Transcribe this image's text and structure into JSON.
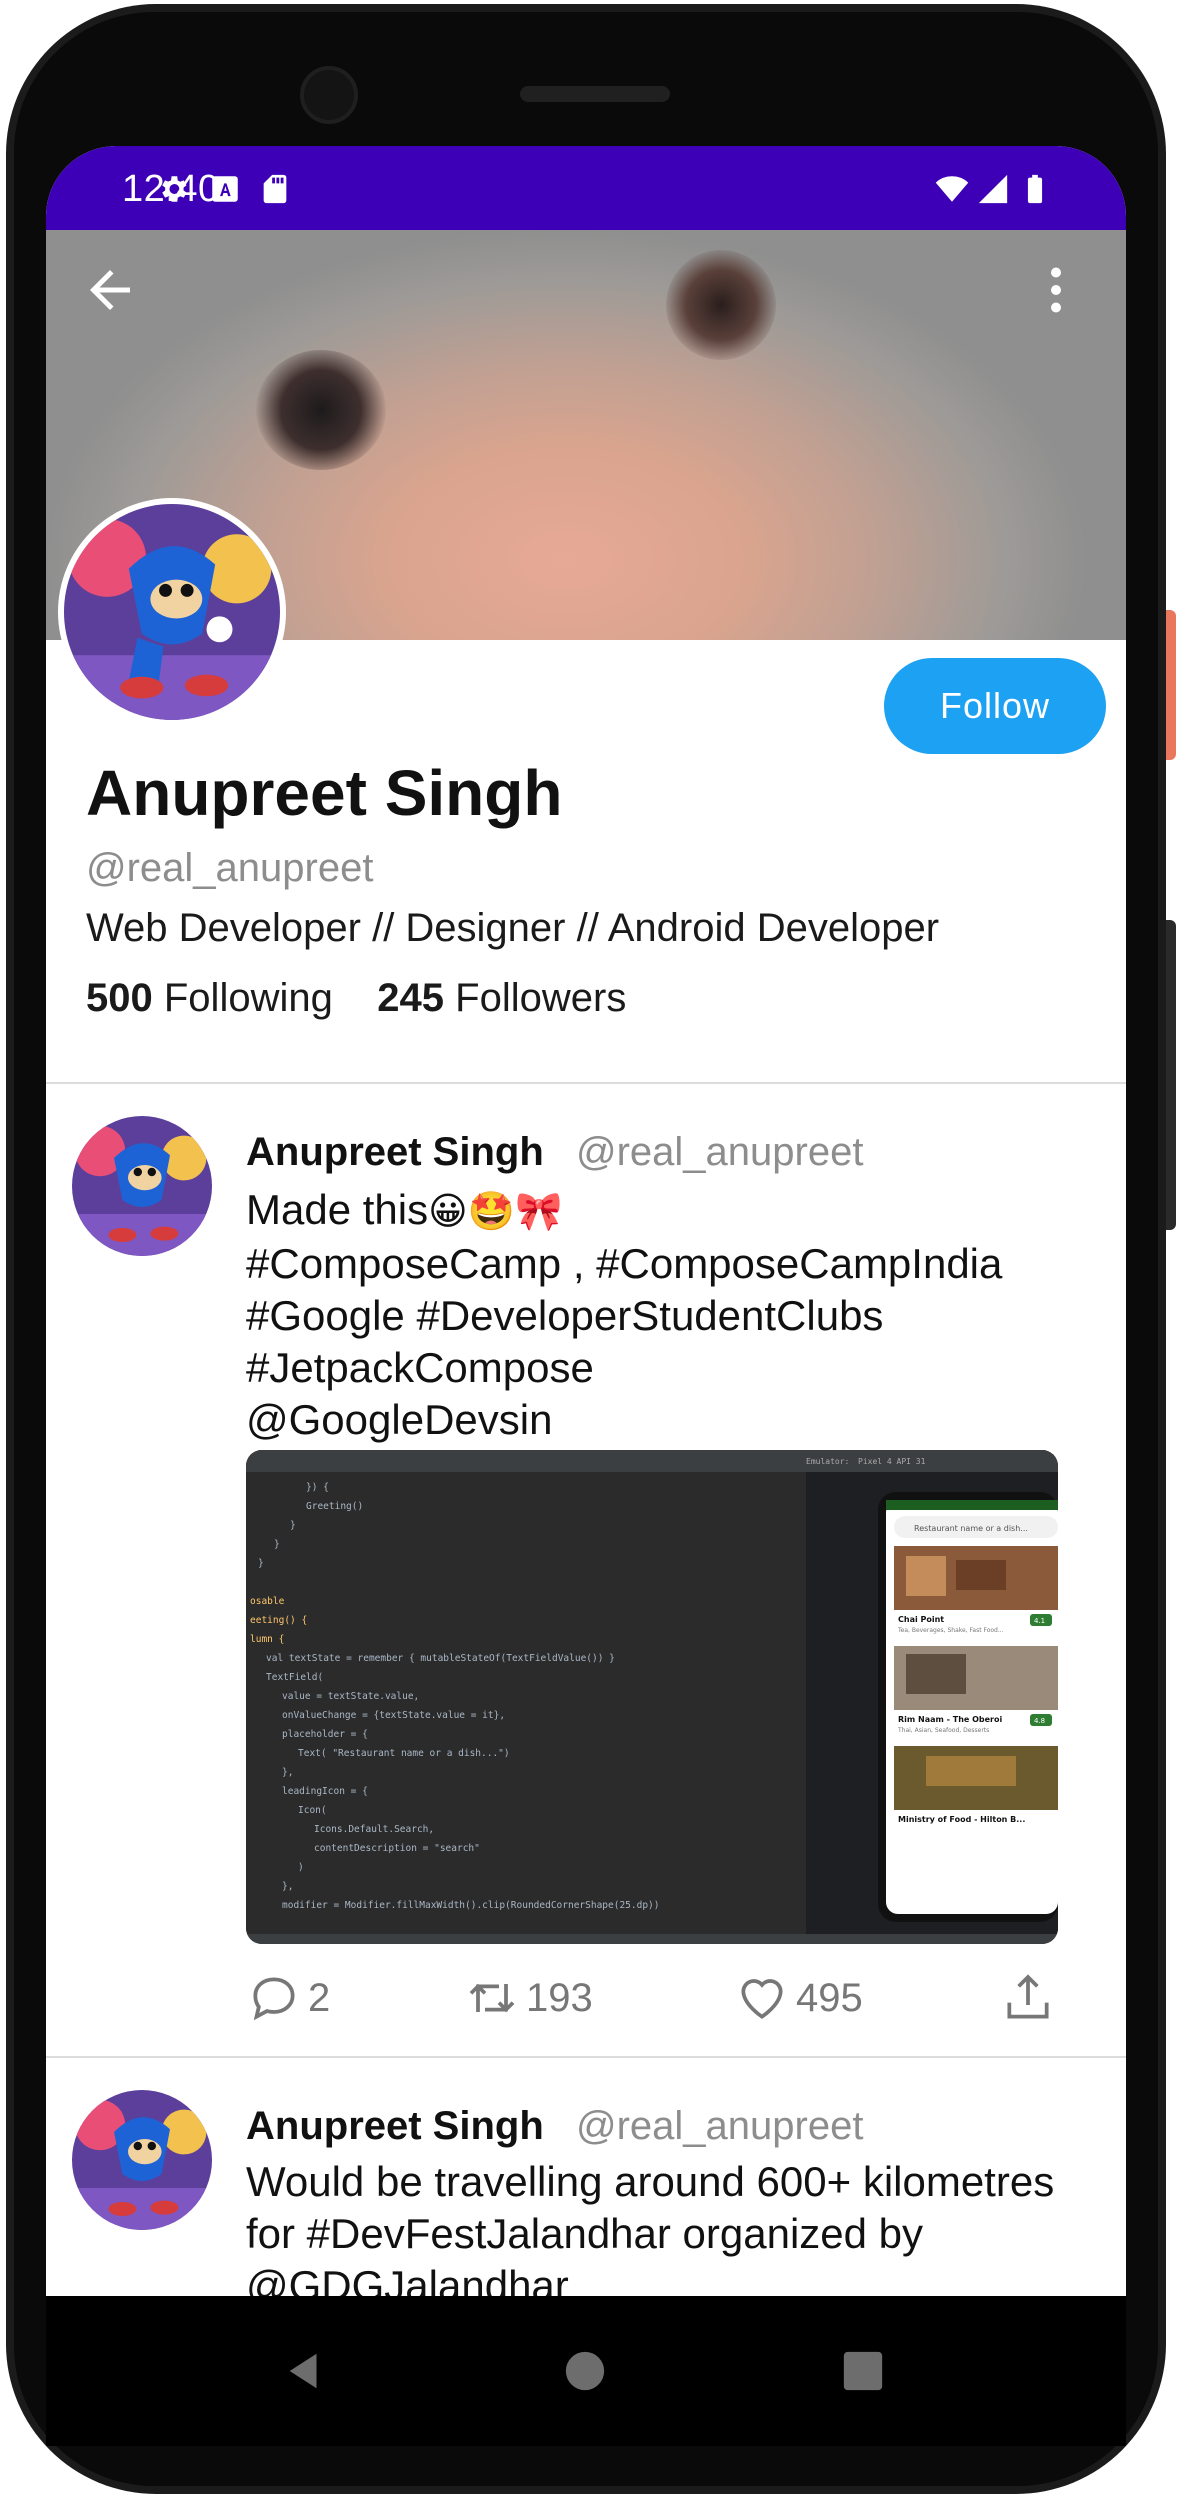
{
  "status_bar": {
    "time": "12:40",
    "left_icons": [
      "settings-icon",
      "text-a-icon",
      "sd-card-icon"
    ],
    "right_icons": [
      "wifi-icon",
      "signal-icon",
      "battery-icon"
    ],
    "background": "#3d00b7"
  },
  "header": {
    "back_icon": "arrow-back-icon",
    "more_icon": "more-vert-icon"
  },
  "profile": {
    "name": "Anupreet Singh",
    "handle": "@real_anupreet",
    "bio": "Web Developer // Designer // Android Developer",
    "following_count": "500",
    "following_label": "Following",
    "followers_count": "245",
    "followers_label": "Followers",
    "follow_button": "Follow",
    "accent": "#1da1f2"
  },
  "tweets": [
    {
      "name": "Anupreet Singh",
      "handle": "@real_anupreet",
      "lines": [
        "Made this",
        "#ComposeCamp , #ComposeCampIndia",
        "#Google #DeveloperStudentClubs",
        "#JetpackCompose",
        "@GoogleDevsin"
      ],
      "emojis": "😀🤩🎀",
      "image": {
        "emulator_label": "Emulator:",
        "device_label": "Pixel 4 API 31",
        "search_placeholder": "Restaurant name or a dish...",
        "cards": [
          {
            "title": "Chai Point",
            "subtitle": "Tea, Beverages, Shake, Fast Food...",
            "rating": "4.1"
          },
          {
            "title": "Rim Naam - The Oberoi",
            "subtitle": "Thai, Asian, Seafood, Desserts",
            "rating": "4.8"
          },
          {
            "title": "Ministry of Food - Hilton B...",
            "subtitle": "",
            "rating": ""
          }
        ],
        "code_lines": [
          "}) {",
          "Greeting()",
          "}",
          "}",
          "}",
          "",
          "osable",
          "eeting() {",
          "lumn {",
          "val textState = remember { mutableStateOf(TextFieldValue()) }",
          "TextField(",
          "value = textState.value,",
          "onValueChange = {textState.value = it},",
          "placeholder = {",
          "Text( \"Restaurant name or a dish...\")",
          "},",
          "leadingIcon = {",
          "Icon(",
          "Icons.Default.Search,",
          "contentDescription = \"search\"",
          ")",
          "},",
          "modifier = Modifier.fillMaxWidth().clip(RoundedCornerShape(25.dp))"
        ]
      },
      "actions": {
        "replies": "2",
        "retweets": "193",
        "likes": "495"
      }
    },
    {
      "name": "Anupreet Singh",
      "handle": "@real_anupreet",
      "lines": [
        "Would be travelling around 600+ kilometres",
        "for #DevFestJalandhar organized by",
        "@GDGJalandhar"
      ]
    }
  ]
}
